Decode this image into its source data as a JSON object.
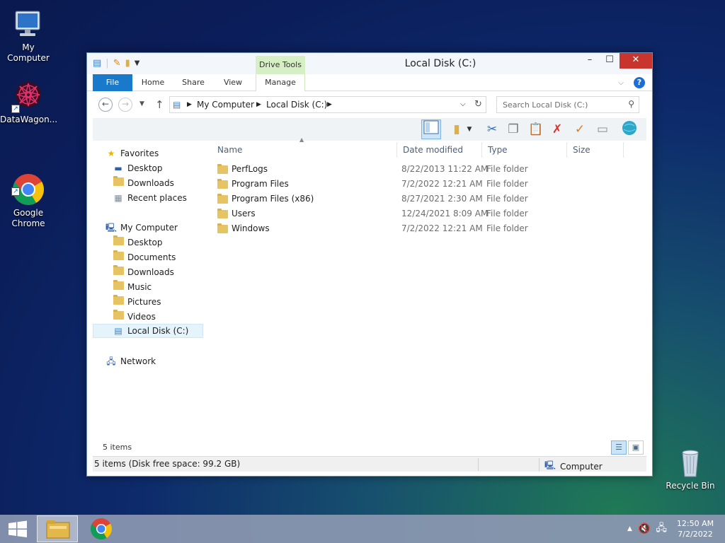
{
  "desktop": {
    "icons": [
      {
        "label": "My Computer",
        "icon": "computer-icon"
      },
      {
        "label": "DataWagon...",
        "icon": "datawagon-icon"
      },
      {
        "label": "Google\nChrome",
        "icon": "chrome-icon"
      },
      {
        "label": "Recycle Bin",
        "icon": "recycle-bin-icon"
      }
    ]
  },
  "window": {
    "title": "Local Disk (C:)",
    "context_tab_header": "Drive Tools",
    "tabs": {
      "file": "File",
      "home": "Home",
      "share": "Share",
      "view": "View",
      "manage": "Manage"
    },
    "controls": {
      "minimize": "–",
      "maximize": "☐",
      "close": "✕"
    },
    "address": {
      "crumbs": [
        "My Computer",
        "Local Disk (C:)"
      ]
    },
    "search": {
      "placeholder": "Search Local Disk (C:)"
    },
    "nav": {
      "favorites": {
        "label": "Favorites",
        "items": [
          "Desktop",
          "Downloads",
          "Recent places"
        ]
      },
      "computer": {
        "label": "My Computer",
        "items": [
          "Desktop",
          "Documents",
          "Downloads",
          "Music",
          "Pictures",
          "Videos",
          "Local Disk (C:)"
        ]
      },
      "network": {
        "label": "Network"
      }
    },
    "columns": {
      "name": "Name",
      "date": "Date modified",
      "type": "Type",
      "size": "Size"
    },
    "files": [
      {
        "name": "PerfLogs",
        "date": "8/22/2013 11:22 AM",
        "type": "File folder"
      },
      {
        "name": "Program Files",
        "date": "7/2/2022 12:21 AM",
        "type": "File folder"
      },
      {
        "name": "Program Files (x86)",
        "date": "8/27/2021 2:30 AM",
        "type": "File folder"
      },
      {
        "name": "Users",
        "date": "12/24/2021 8:09 AM",
        "type": "File folder"
      },
      {
        "name": "Windows",
        "date": "7/2/2022 12:21 AM",
        "type": "File folder"
      }
    ],
    "item_count": "5 items",
    "status": {
      "left": "5 items (Disk free space: 99.2 GB)",
      "right": "Computer"
    }
  },
  "taskbar": {
    "clock_time": "12:50 AM",
    "clock_date": "7/2/2022"
  },
  "colors": {
    "file_tab": "#1979ca",
    "close_button": "#c7352e",
    "context_tab": "#d6efc4"
  }
}
